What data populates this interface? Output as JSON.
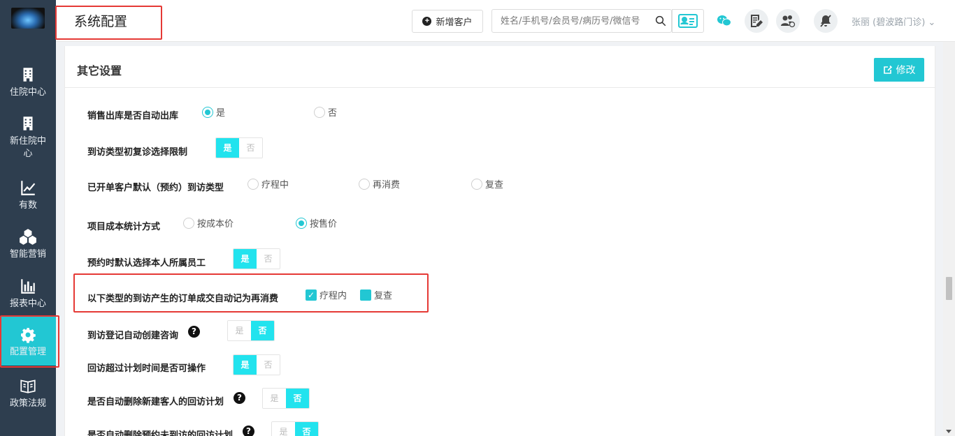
{
  "header": {
    "title": "系统配置",
    "add_customer_label": "新增客户",
    "search_placeholder": "姓名/手机号/会员号/病历号/微信号",
    "user": "张丽 (碧波路门诊)"
  },
  "sidebar": {
    "items": [
      {
        "label": "住院中心",
        "icon": "building-icon"
      },
      {
        "label": "新住院中心",
        "icon": "building-icon"
      },
      {
        "label": "有数",
        "icon": "trend-chart-icon"
      },
      {
        "label": "智能营销",
        "icon": "cubes-icon"
      },
      {
        "label": "报表中心",
        "icon": "bar-chart-icon"
      },
      {
        "label": "配置管理",
        "icon": "gear-icon",
        "active": true
      },
      {
        "label": "政策法规",
        "icon": "book-icon"
      }
    ]
  },
  "main": {
    "section_title": "其它设置",
    "edit_label": "修改",
    "settings": [
      {
        "label": "销售出库是否自动出库",
        "type": "radio",
        "options": [
          "是",
          "否"
        ],
        "selected": "是"
      },
      {
        "label": "到访类型初复诊选择限制",
        "type": "toggle",
        "options": [
          "是",
          "否"
        ],
        "selected": "是"
      },
      {
        "label": "已开单客户默认（预约）到访类型",
        "type": "radio",
        "options": [
          "疗程中",
          "再消费",
          "复查"
        ],
        "selected": ""
      },
      {
        "label": "项目成本统计方式",
        "type": "radio",
        "options": [
          "按成本价",
          "按售价"
        ],
        "selected": "按售价"
      },
      {
        "label": "预约时默认选择本人所属员工",
        "type": "toggle",
        "options": [
          "是",
          "否"
        ],
        "selected": "是"
      },
      {
        "label": "以下类型的到访产生的订单成交自动记为再消费",
        "type": "checkbox",
        "options": [
          "疗程内",
          "复查"
        ],
        "checked": [
          "疗程内",
          "复查"
        ]
      },
      {
        "label": "到访登记自动创建咨询",
        "type": "toggle",
        "options": [
          "是",
          "否"
        ],
        "selected": "否",
        "help": true
      },
      {
        "label": "回访超过计划时间是否可操作",
        "type": "toggle",
        "options": [
          "是",
          "否"
        ],
        "selected": "是"
      },
      {
        "label": "是否自动删除新建客人的回访计划",
        "type": "toggle",
        "options": [
          "是",
          "否"
        ],
        "selected": "否",
        "help": true
      },
      {
        "label": "是否自动删除预约未到访的回访计划",
        "type": "toggle",
        "options": [
          "是",
          "否"
        ],
        "selected": "否",
        "help": true
      }
    ]
  },
  "colors": {
    "accent": "#22c7d3",
    "sidebar_bg": "#2e3e4f",
    "highlight": "#e53935"
  }
}
